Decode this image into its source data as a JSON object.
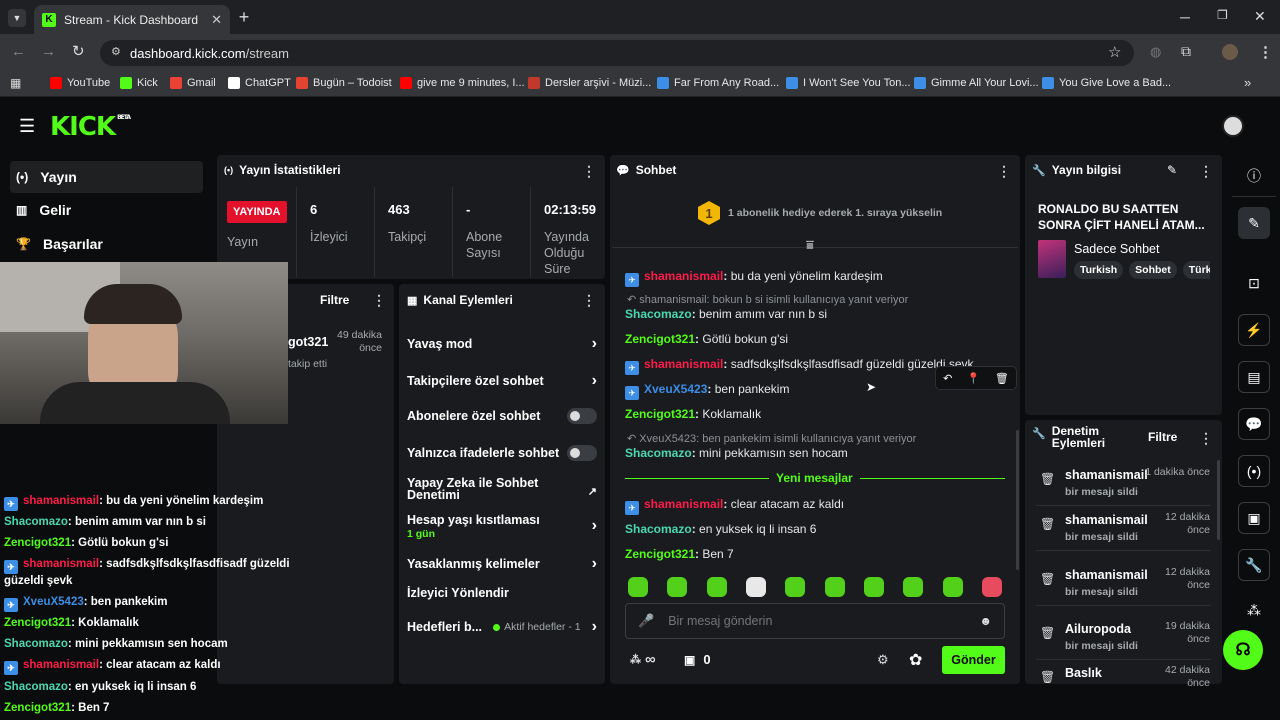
{
  "browser": {
    "tab_title": "Stream - Kick Dashboard",
    "url_host": "dashboard.kick.com",
    "url_path": "/stream",
    "bookmarks": [
      {
        "label": "YouTube",
        "color": "#ff0000"
      },
      {
        "label": "Kick",
        "color": "#53fc18"
      },
      {
        "label": "Gmail",
        "color": "#ea4335"
      },
      {
        "label": "ChatGPT",
        "color": "#ffffff"
      },
      {
        "label": "Bugün – Todoist",
        "color": "#e44332"
      },
      {
        "label": "give me 9 minutes, I...",
        "color": "#ff0000"
      },
      {
        "label": "Dersler arşivi - Müzi...",
        "color": "#c0392b"
      },
      {
        "label": "Far From Any Road...",
        "color": "#3c8ee6"
      },
      {
        "label": "I Won't See You Ton...",
        "color": "#3c8ee6"
      },
      {
        "label": "Gimme All Your Lovi...",
        "color": "#3c8ee6"
      },
      {
        "label": "You Give Love a Bad...",
        "color": "#3c8ee6"
      }
    ]
  },
  "header": {
    "logo": "KICK",
    "logo_badge": "BETA"
  },
  "nav": [
    {
      "label": "Yayın",
      "icon": "broadcast-icon"
    },
    {
      "label": "Gelir",
      "icon": "chart-icon"
    },
    {
      "label": "Başarılar",
      "icon": "trophy-icon"
    }
  ],
  "stats": {
    "title": "Yayın İstatistikleri",
    "live_label": "YAYINDA",
    "stream_label": "Yayın",
    "viewers_value": "6",
    "viewers_label": "İzleyici",
    "followers_value": "463",
    "followers_label": "Takipçi",
    "subs_value": "-",
    "subs_label_1": "Abone",
    "subs_label_2": "Sayısı",
    "uptime_value": "02:13:59",
    "uptime_label_1": "Yayında",
    "uptime_label_2": "Olduğu",
    "uptime_label_3": "Süre"
  },
  "activity": {
    "filter_label": "Filtre",
    "user_fragment": "got321",
    "time_1": "49 dakika",
    "time_2": "önce",
    "action": "takip etti"
  },
  "channel_actions": {
    "title": "Kanal Eylemleri",
    "items": [
      {
        "label": "Yavaş mod",
        "control": "chevron"
      },
      {
        "label": "Takipçilere özel sohbet",
        "control": "chevron"
      },
      {
        "label": "Abonelere özel sohbet",
        "control": "toggle"
      },
      {
        "label": "Yalnızca ifadelerle sohbet",
        "control": "toggle"
      }
    ],
    "ai_label_1": "Yapay Zeka ile Sohbet",
    "ai_label_2": "Denetimi",
    "age_label": "Hesap yaşı kısıtlaması",
    "age_value": "1 gün",
    "banned_words": "Yasaklanmış kelimeler",
    "viewer_redirect": "İzleyici Yönlendir",
    "goals_label": "Hedefleri b...",
    "goals_status": "Aktif hedefler - 1"
  },
  "chat": {
    "title": "Sohbet",
    "gift_banner": "1 abonelik hediye ederek 1. sıraya yükselin",
    "gift_rank": "1",
    "messages": [
      {
        "type": "msg",
        "badge": true,
        "user": "shamanismail",
        "color": "red",
        "text": "bu da yeni yönelim kardeşim"
      },
      {
        "type": "reply",
        "text": "shamanismail: bokun b si isimli kullanıcıya yanıt veriyor"
      },
      {
        "type": "msg",
        "badge": false,
        "user": "Shacomazo",
        "color": "teal",
        "text": "benim amım var nın b si"
      },
      {
        "type": "msg",
        "badge": false,
        "user": "Zencigot321",
        "color": "green",
        "text": "Götlü bokun g'si"
      },
      {
        "type": "msg",
        "badge": true,
        "user": "shamanismail",
        "color": "red",
        "text": "sadfsdkşlfsdkşlfasdfisadf güzeldi güzeldi şevk"
      },
      {
        "type": "msg",
        "badge": true,
        "user": "XveuX5423",
        "color": "blue",
        "text": "ben pankekim"
      },
      {
        "type": "msg",
        "badge": false,
        "user": "Zencigot321",
        "color": "green",
        "text": "Koklamalık"
      },
      {
        "type": "reply",
        "text": "XveuX5423: ben pankekim isimli kullanıcıya yanıt veriyor"
      },
      {
        "type": "msg",
        "badge": false,
        "user": "Shacomazo",
        "color": "teal",
        "text": "mini pekkamısın sen hocam"
      }
    ],
    "new_messages": "Yeni mesajlar",
    "messages_after": [
      {
        "badge": true,
        "user": "shamanismail",
        "color": "red",
        "text": "clear atacam az kaldı"
      },
      {
        "badge": false,
        "user": "Shacomazo",
        "color": "teal",
        "text": "en yuksek iq li insan 6"
      },
      {
        "badge": false,
        "user": "Zencigot321",
        "color": "green",
        "text": "Ben 7"
      }
    ],
    "input_placeholder": "Bir mesaj gönderin",
    "infinity": "∞",
    "points": "0",
    "send_label": "Gönder"
  },
  "overlay_chat": [
    {
      "badge": true,
      "user": "shamanismail",
      "color": "red",
      "text": "bu da yeni yönelim kardeşim"
    },
    {
      "badge": false,
      "user": "Shacomazo",
      "color": "teal",
      "text": "benim amım var nın b si"
    },
    {
      "badge": false,
      "user": "Zencigot321",
      "color": "green",
      "text": "Götlü bokun g'si"
    },
    {
      "badge": true,
      "user": "shamanismail",
      "color": "red",
      "text": "sadfsdkşlfsdkşlfasdfisadf güzeldi güzeldi şevk"
    },
    {
      "badge": true,
      "user": "XveuX5423",
      "color": "blue",
      "text": "ben pankekim"
    },
    {
      "badge": false,
      "user": "Zencigot321",
      "color": "green",
      "text": "Koklamalık"
    },
    {
      "badge": false,
      "user": "Shacomazo",
      "color": "teal",
      "text": "mini pekkamısın sen hocam"
    },
    {
      "badge": true,
      "user": "shamanismail",
      "color": "red",
      "text": "clear atacam az kaldı"
    },
    {
      "badge": false,
      "user": "Shacomazo",
      "color": "teal",
      "text": "en yuksek iq li insan 6"
    },
    {
      "badge": false,
      "user": "Zencigot321",
      "color": "green",
      "text": "Ben 7"
    }
  ],
  "stream_info": {
    "title": "Yayın bilgisi",
    "stream_title": "RONALDO BU SAATTEN SONRA ÇİFT HANELİ ATAM...",
    "category": "Sadece Sohbet",
    "tags": [
      "Turkish",
      "Sohbet",
      "Türk"
    ]
  },
  "moderation": {
    "title_1": "Denetim",
    "title_2": "Eylemleri",
    "filter_label": "Filtre",
    "items": [
      {
        "user": "shamanismail",
        "time": "1 dakika önce",
        "action": "bir mesajı sildi"
      },
      {
        "user": "shamanismail",
        "time": "12 dakika önce",
        "action": "bir mesajı sildi"
      },
      {
        "user": "shamanismail",
        "time": "12 dakika önce",
        "action": "bir mesajı sildi"
      },
      {
        "user": "Ailuropoda",
        "time": "19 dakika önce",
        "action": "bir mesajı sildi"
      },
      {
        "user": "Baslık",
        "time": "42 dakika önce",
        "action": ""
      }
    ]
  }
}
